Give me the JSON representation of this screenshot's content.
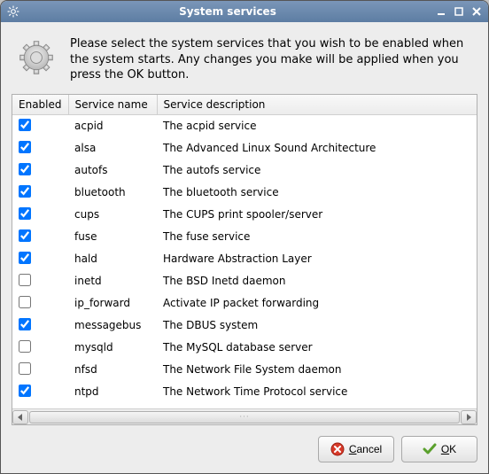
{
  "window": {
    "title": "System services",
    "intro": "Please select the system services that you wish to be enabled when the system starts. Any changes you make will be applied when you press the OK button."
  },
  "columns": {
    "enabled": "Enabled",
    "name": "Service name",
    "desc": "Service description"
  },
  "services": [
    {
      "enabled": true,
      "name": "acpid",
      "desc": "The acpid service"
    },
    {
      "enabled": true,
      "name": "alsa",
      "desc": "The Advanced Linux Sound Architecture"
    },
    {
      "enabled": true,
      "name": "autofs",
      "desc": "The autofs service"
    },
    {
      "enabled": true,
      "name": "bluetooth",
      "desc": "The bluetooth service"
    },
    {
      "enabled": true,
      "name": "cups",
      "desc": "The CUPS print spooler/server"
    },
    {
      "enabled": true,
      "name": "fuse",
      "desc": "The fuse service"
    },
    {
      "enabled": true,
      "name": "hald",
      "desc": "Hardware Abstraction Layer"
    },
    {
      "enabled": false,
      "name": "inetd",
      "desc": "The BSD Inetd daemon"
    },
    {
      "enabled": false,
      "name": "ip_forward",
      "desc": "Activate IP packet forwarding"
    },
    {
      "enabled": true,
      "name": "messagebus",
      "desc": "The DBUS system"
    },
    {
      "enabled": false,
      "name": "mysqld",
      "desc": "The MySQL database server"
    },
    {
      "enabled": false,
      "name": "nfsd",
      "desc": "The Network File System daemon"
    },
    {
      "enabled": true,
      "name": "ntpd",
      "desc": "The Network Time Protocol service"
    }
  ],
  "buttons": {
    "cancel": "Cancel",
    "ok": "OK"
  },
  "icons": {
    "app": "gear-icon",
    "cancel": "cancel-icon",
    "ok": "ok-icon",
    "minimize": "minimize-icon",
    "maximize": "maximize-icon",
    "close": "close-icon"
  }
}
